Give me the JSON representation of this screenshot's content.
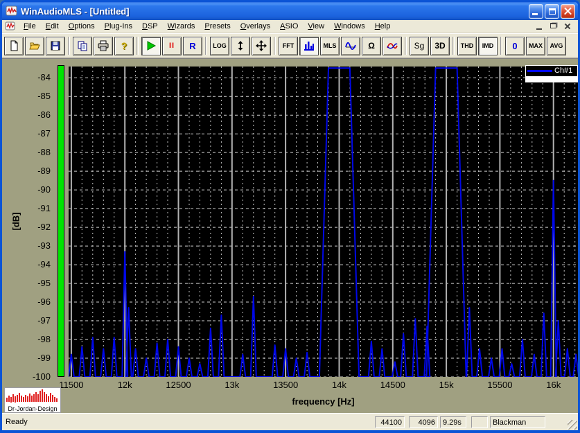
{
  "window": {
    "title": "WinAudioMLS - [Untitled]"
  },
  "menubar": {
    "items": [
      "File",
      "Edit",
      "Options",
      "Plug-Ins",
      "DSP",
      "Wizards",
      "Presets",
      "Overlays",
      "ASIO",
      "View",
      "Windows",
      "Help"
    ]
  },
  "toolbar": {
    "labels": {
      "pause": "II",
      "record": "R",
      "log": "LOG",
      "fft": "FFT",
      "mls": "MLS",
      "omega": "Ω",
      "sg": "Sg",
      "threed": "3D",
      "thd": "THD",
      "imd": "IMD",
      "zero": "0",
      "max": "MAX",
      "avg": "AVG",
      "help": "?"
    }
  },
  "statusbar": {
    "ready": "Ready",
    "panels": [
      "44100",
      "4096",
      "9.29s",
      "",
      "Blackman"
    ]
  },
  "logo": {
    "text": "Dr-Jordan-Design"
  },
  "chart_data": {
    "type": "line",
    "title": "",
    "xlabel": "frequency [Hz]",
    "ylabel": "[dB]",
    "legend": [
      "Ch#1"
    ],
    "legend_position": "top-right",
    "background": "#000000",
    "series_color": "#0008e8",
    "grid": true,
    "xlim": [
      11475,
      16228
    ],
    "ylim": [
      -100,
      -83.4
    ],
    "x_major_ticks": [
      11500,
      12000,
      12500,
      13000,
      13500,
      14000,
      14500,
      15000,
      15500,
      16000
    ],
    "x_tick_labels": [
      "11500",
      "12k",
      "12500",
      "13k",
      "13500",
      "14k",
      "14500",
      "15k",
      "15500",
      "16k"
    ],
    "x_minor_step_hz": 100,
    "y_ticks": [
      -84,
      -85,
      -86,
      -87,
      -88,
      -89,
      -90,
      -91,
      -92,
      -93,
      -94,
      -95,
      -96,
      -97,
      -98,
      -99,
      -100
    ],
    "noise_floor_db": -100,
    "peak_halfwidth_hz": 26,
    "tones": [
      {
        "f": 14000,
        "top_db": -83.48,
        "top_hw": 100,
        "base_hw": 185
      },
      {
        "f": 15000,
        "top_db": -83.48,
        "top_hw": 100,
        "base_hw": 185
      }
    ],
    "peaks": [
      [
        11500,
        -98.8
      ],
      [
        11600,
        -98.4
      ],
      [
        11700,
        -97.9
      ],
      [
        11800,
        -98.5
      ],
      [
        11900,
        -97.9
      ],
      [
        12000,
        -93.3
      ],
      [
        12035,
        -96.3
      ],
      [
        12100,
        -98.5
      ],
      [
        12200,
        -99.0
      ],
      [
        12300,
        -98.2
      ],
      [
        12400,
        -98.0
      ],
      [
        12500,
        -98.4
      ],
      [
        12600,
        -99.0
      ],
      [
        12700,
        -99.3
      ],
      [
        12800,
        -97.4
      ],
      [
        12900,
        -96.7
      ],
      [
        13100,
        -98.8
      ],
      [
        13200,
        -95.7
      ],
      [
        13400,
        -98.3
      ],
      [
        13500,
        -98.5
      ],
      [
        13600,
        -99.0
      ],
      [
        13700,
        -98.7
      ],
      [
        14300,
        -98.1
      ],
      [
        14400,
        -98.5
      ],
      [
        14520,
        -99.2
      ],
      [
        14600,
        -97.7
      ],
      [
        14710,
        -96.9
      ],
      [
        14820,
        -97.3
      ],
      [
        15215,
        -96.3
      ],
      [
        15310,
        -98.5
      ],
      [
        15420,
        -99.0
      ],
      [
        15520,
        -98.5
      ],
      [
        15610,
        -99.3
      ],
      [
        15710,
        -98.0
      ],
      [
        15820,
        -98.8
      ],
      [
        15910,
        -96.6
      ],
      [
        16000,
        -89.5
      ],
      [
        16045,
        -97.0
      ],
      [
        16130,
        -98.5
      ],
      [
        16210,
        -98.8
      ]
    ]
  }
}
